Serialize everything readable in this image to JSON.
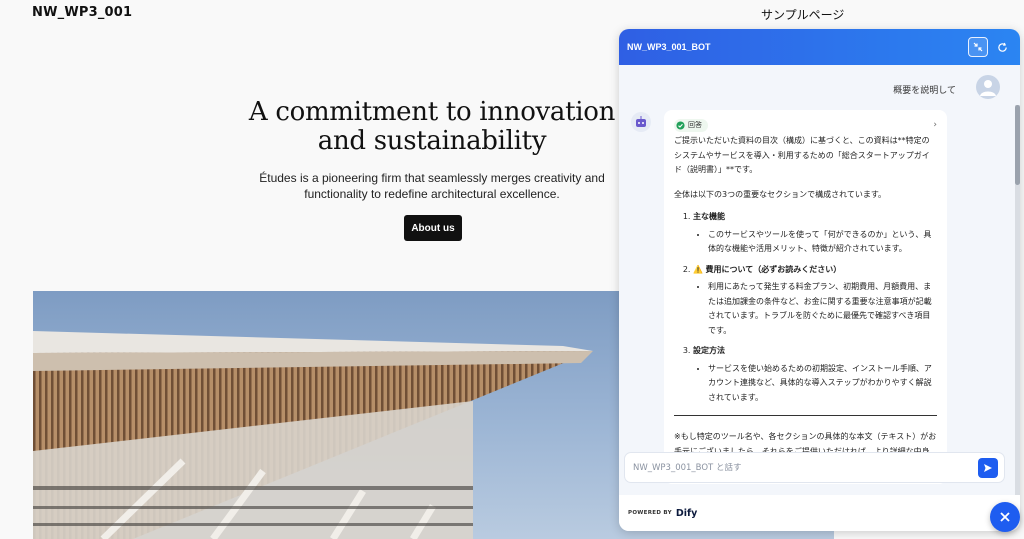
{
  "site": {
    "title": "NW_WP3_001",
    "nav_link": "サンプルページ"
  },
  "hero": {
    "heading": "A commitment to innovation and sustainability",
    "body": "Études is a pioneering firm that seamlessly merges creativity and functionality to redefine architectural excellence.",
    "button": "About us"
  },
  "chat": {
    "title": "NW_WP3_001_BOT",
    "user_message": "概要を説明して",
    "answer": {
      "tag": "回答",
      "intro": "ご提示いただいた資料の目次（構成）に基づくと、この資料は**特定のシステムやサービスを導入・利用するための「総合スタートアップガイド（説明書）」**です。",
      "summary": "全体は以下の3つの重要なセクションで構成されています。",
      "sections": [
        {
          "title": "主な機能",
          "icon": "",
          "detail": "このサービスやツールを使って「何ができるのか」という、具体的な機能や活用メリット、特徴が紹介されています。"
        },
        {
          "title": "費用について（必ずお読みください）",
          "icon": "warning-icon",
          "detail": "利用にあたって発生する料金プラン、初期費用、月額費用、または追加課金の条件など、お金に関する重要な注意事項が記載されています。トラブルを防ぐために最優先で確認すべき項目です。"
        },
        {
          "title": "設定方法",
          "icon": "",
          "detail": "サービスを使い始めるための初期設定、インストール手順、アカウント連携など、具体的な導入ステップがわかりやすく解説されています。"
        }
      ],
      "note": "※もし特定のツール名や、各セクションの具体的な本文（テキスト）がお手元にございましたら、それらをご提供いただければ、より詳細な中身の要約や具体的な"
    },
    "input_placeholder": "NW_WP3_001_BOT と話す",
    "footer_powered": "POWERED BY",
    "footer_brand": "Dify"
  },
  "colors": {
    "accent": "#1e5df0",
    "header_start": "#2f5fe4",
    "header_end": "#2b85f2",
    "dark_button": "#111111"
  }
}
